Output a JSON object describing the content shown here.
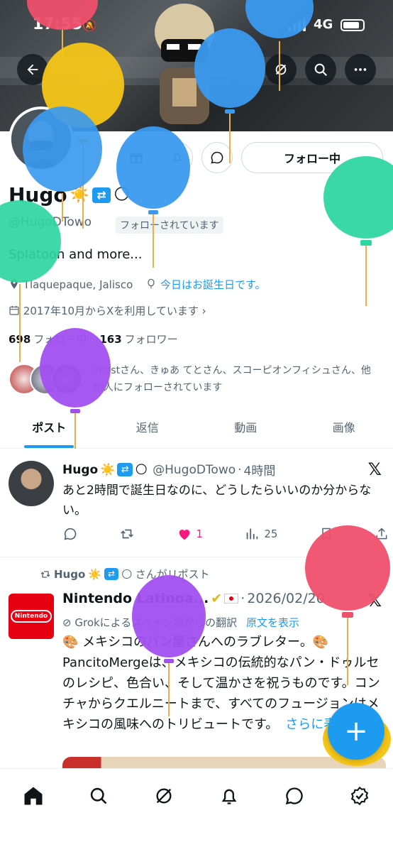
{
  "status": {
    "time": "17:55",
    "network": "4G"
  },
  "profile": {
    "name": "Hugo",
    "name_emojis": [
      "☀️",
      "🔁",
      "🌕"
    ],
    "handle": "@HugoDTowo",
    "follows_you": "フォローされています",
    "bio": "Splatoon and more...",
    "location": "Tlaquepaque, Jalisco",
    "birthday": "今日はお誕生日です。",
    "joined": "2017年10月からXを利用しています",
    "following_count": "698",
    "following_label": "フォロー中",
    "followers_count": "163",
    "followers_label": "フォロワー",
    "mutuals": "Ghostさん、きゅあ てとさん、スコーピオンフィシュさん、他30人にフォローされています",
    "follow_button": "フォロー中"
  },
  "tabs": [
    {
      "label": "ポスト",
      "active": true
    },
    {
      "label": "返信",
      "active": false
    },
    {
      "label": "動画",
      "active": false
    },
    {
      "label": "画像",
      "active": false
    }
  ],
  "posts": [
    {
      "name": "Hugo",
      "handle": "@HugoDTowo",
      "time": "4時間",
      "text": "あと2時間で誕生日なのに、どうしたらいいのか分からない。",
      "likes": "1",
      "views": "25"
    },
    {
      "repost_by": "Hugo",
      "repost_suffix": "さんがリポスト",
      "name": "Nintendo Latinoa...",
      "date": "2026/02/20",
      "grok": "Grokによるスペイン語からの翻訳",
      "show_original": "原文を表示",
      "text": "🎨 メキシコのパン屋さんへのラブレター。🎨 PancitoMergeは、メキシコの伝統的なパン・ドゥルセのレシピ、色合い、そして温かさを祝うものです。コンチャからクエルニートまで、すべてのフュージョンはメキシコの風味へのトリビュートです。",
      "show_more": "さらに表示",
      "logo_text": "Nintendo"
    }
  ],
  "colors": {
    "accent": "#1d9bf0",
    "like": "#f91880",
    "text": "#0f1419",
    "muted": "#536471"
  },
  "icons": [
    "back-arrow-icon",
    "grok-icon",
    "search-icon",
    "more-icon",
    "gift-icon",
    "notify-icon",
    "message-icon",
    "location-icon",
    "balloon-icon",
    "calendar-icon",
    "reply-icon",
    "retweet-icon",
    "heart-icon",
    "views-icon",
    "bookmark-icon",
    "share-icon",
    "x-logo-icon",
    "home-icon",
    "notifications-icon",
    "premium-icon"
  ]
}
